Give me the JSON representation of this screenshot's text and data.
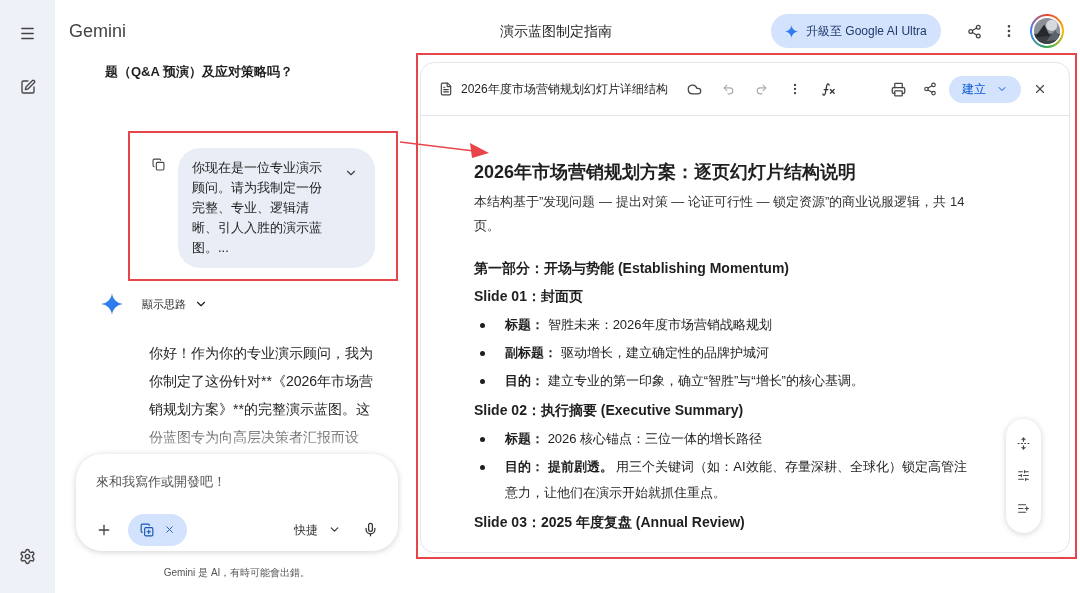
{
  "header": {
    "brand": "Gemini",
    "title": "演示蓝图制定指南",
    "upgrade_button": "升級至 Google AI Ultra"
  },
  "chat": {
    "previous_prompt_tail": "题（Q&A 预演）及应对策略吗？",
    "user_message": "你现在是一位专业演示顾问。请为我制定一份完整、专业、逻辑清晰、引人入胜的演示蓝图。...",
    "thoughts_toggle": "顯示思路",
    "response": "你好！作为你的专业演示顾问，我为你制定了这份针对**《2026年市场营销规划方案》**的完整演示蓝图。这份蓝图专为向高层决策者汇报而设",
    "input": {
      "placeholder": "來和我寫作或開發吧！",
      "mode_button": "快捷"
    },
    "disclaimer": "Gemini 是 AI，有時可能會出錯。"
  },
  "document": {
    "file_name": "2026年度市场营销规划幻灯片详细结构",
    "create_button": "建立",
    "title": "2026年市场营销规划方案：逐页幻灯片结构说明",
    "intro": "本结构基于”发现问题 — 提出对策 — 论证可行性 — 锁定资源”的商业说服逻辑，共 14 页。",
    "blocks": [
      {
        "kind": "heading",
        "text": "第一部分：开场与势能 (Establishing Momentum)"
      },
      {
        "kind": "heading",
        "text": "Slide 01：封面页"
      },
      {
        "kind": "bullet",
        "label": "标题：",
        "text": "智胜未来：2026年度市场营销战略规划"
      },
      {
        "kind": "bullet",
        "label": "副标题：",
        "text": "驱动增长，建立确定性的品牌护城河"
      },
      {
        "kind": "bullet",
        "label": "目的：",
        "text": "建立专业的第一印象，确立“智胜”与“增长”的核心基调。"
      },
      {
        "kind": "heading",
        "text": "Slide 02：执行摘要 (Executive Summary)"
      },
      {
        "kind": "bullet",
        "label": "标题：",
        "text": "2026 核心锚点：三位一体的增长路径"
      },
      {
        "kind": "bullet",
        "label": "目的：",
        "text": "**提前剧透。** 用三个关键词（如：AI效能、存量深耕、全球化）锁定高管注意力，让他们在演示开始就抓住重点。"
      },
      {
        "kind": "heading",
        "text": "Slide 03：2025 年度复盘 (Annual Review)"
      }
    ]
  }
}
